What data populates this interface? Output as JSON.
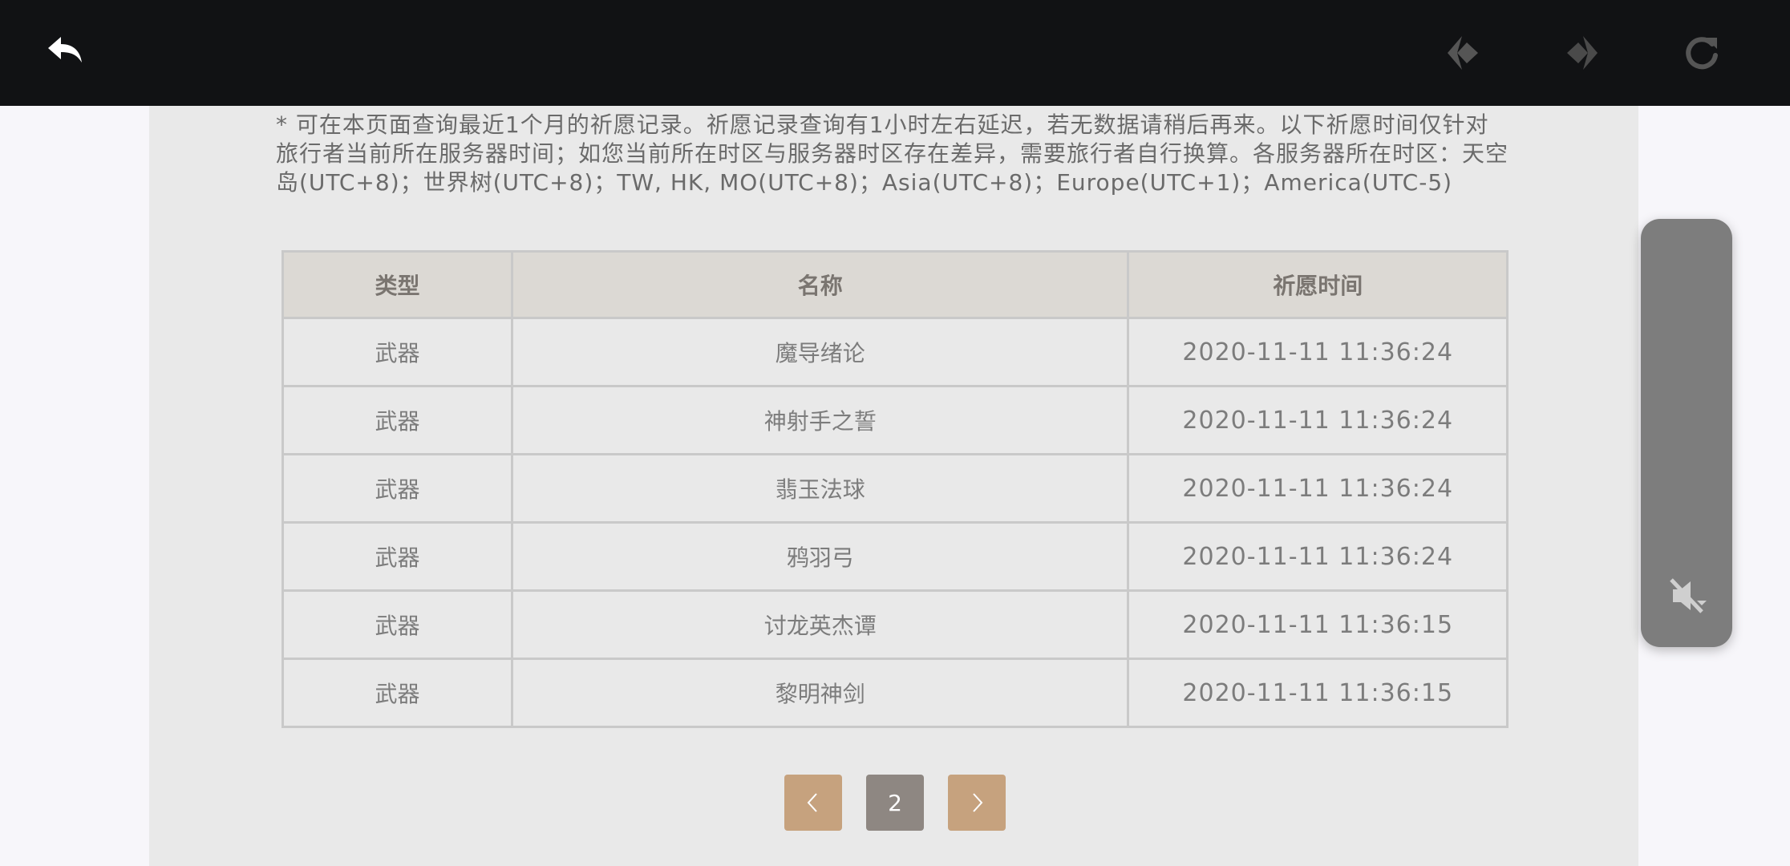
{
  "topbar": {
    "icons": {
      "back": "back-arrow-icon",
      "prev": "nav-prev-icon",
      "next": "nav-next-icon",
      "refresh": "refresh-icon"
    }
  },
  "notice": "* 可在本页面查询最近1个月的祈愿记录。祈愿记录查询有1小时左右延迟，若无数据请稍后再来。以下祈愿时间仅针对旅行者当前所在服务器时间；如您当前所在时区与服务器时区存在差异，需要旅行者自行换算。各服务器所在时区：天空岛(UTC+8)；世界树(UTC+8)；TW, HK, MO(UTC+8)；Asia(UTC+8)；Europe(UTC+1)；America(UTC-5)",
  "table": {
    "headers": {
      "type": "类型",
      "name": "名称",
      "time": "祈愿时间"
    },
    "rows": [
      {
        "type": "武器",
        "name": "魔导绪论",
        "time": "2020-11-11 11:36:24"
      },
      {
        "type": "武器",
        "name": "神射手之誓",
        "time": "2020-11-11 11:36:24"
      },
      {
        "type": "武器",
        "name": "翡玉法球",
        "time": "2020-11-11 11:36:24"
      },
      {
        "type": "武器",
        "name": "鸦羽弓",
        "time": "2020-11-11 11:36:24"
      },
      {
        "type": "武器",
        "name": "讨龙英杰谭",
        "time": "2020-11-11 11:36:15"
      },
      {
        "type": "武器",
        "name": "黎明神剑",
        "time": "2020-11-11 11:36:15"
      }
    ]
  },
  "pagination": {
    "current_page": "2",
    "prev_icon": "chevron-left-icon",
    "next_icon": "chevron-right-icon"
  },
  "side_panel": {
    "icon": "mute-icon"
  },
  "colors": {
    "topbar": "#111214",
    "panel": "#e9e9e9",
    "header_bg": "#dcd9d4",
    "pager_accent": "#c6a27e",
    "pager_current": "#8e8782"
  }
}
